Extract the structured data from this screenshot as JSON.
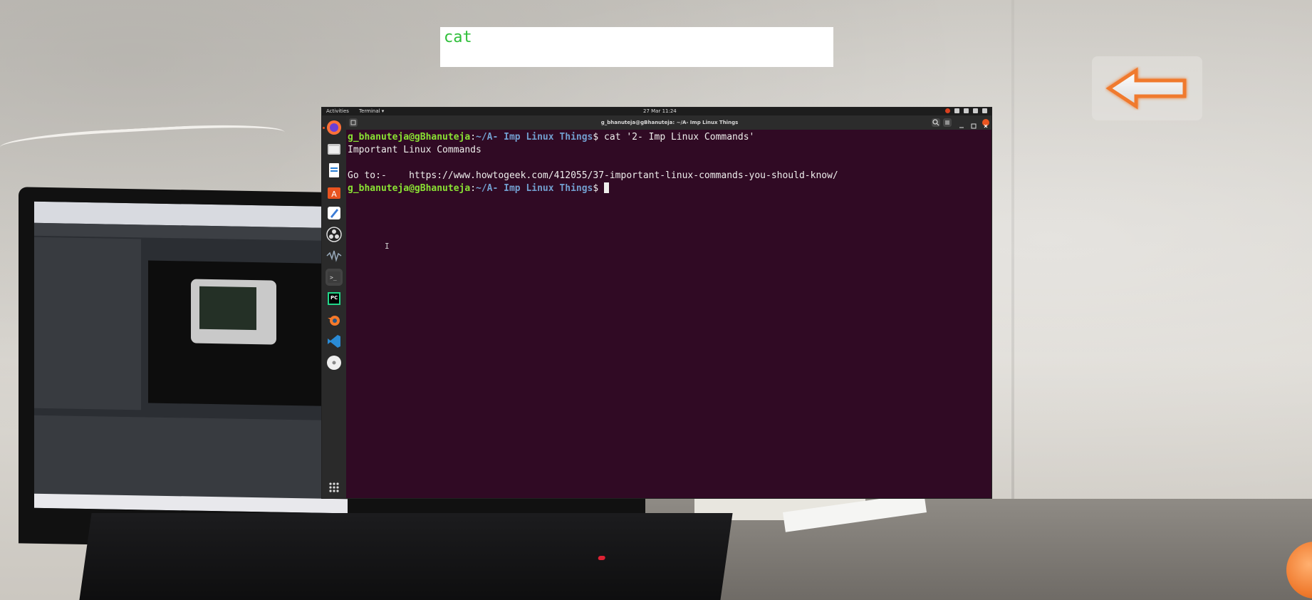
{
  "ar_overlay": {
    "command_label": "cat"
  },
  "topbar": {
    "activities": "Activities",
    "app_menu": "Terminal ▾",
    "clock": "27 Mar  11:24"
  },
  "dock": {
    "items": [
      {
        "name": "firefox-icon",
        "color": "#ff7139"
      },
      {
        "name": "files-icon",
        "color": "#c9c9c9"
      },
      {
        "name": "writer-icon",
        "color": "#2a7fd4"
      },
      {
        "name": "software-icon",
        "color": "#e95420"
      },
      {
        "name": "text-editor-icon",
        "color": "#3a7bd5"
      },
      {
        "name": "obs-icon",
        "color": "#dddddd"
      },
      {
        "name": "audacity-icon",
        "color": "#999999"
      },
      {
        "name": "terminal-icon",
        "color": "#3c3c3c"
      },
      {
        "name": "pycharm-icon",
        "color": "#21d789"
      },
      {
        "name": "blender-icon",
        "color": "#f5792a"
      },
      {
        "name": "vscode-icon",
        "color": "#2a8bd6"
      },
      {
        "name": "disc-icon",
        "color": "#eeeeee"
      },
      {
        "name": "app-grid-icon",
        "color": "#dddddd"
      }
    ]
  },
  "terminal": {
    "title": "g_bhanuteja@gBhanuteja: ~/A- Imp Linux Things",
    "prompt_user": "g_bhanuteja@gBhanuteja",
    "prompt_sep": ":",
    "prompt_path": "~/A- Imp Linux Things",
    "prompt_dollar": "$ ",
    "command": "cat '2- Imp Linux Commands'",
    "output_line1": "Important Linux Commands",
    "output_line2": "Go to:-    https://www.howtogeek.com/412055/37-important-linux-commands-you-should-know/"
  }
}
